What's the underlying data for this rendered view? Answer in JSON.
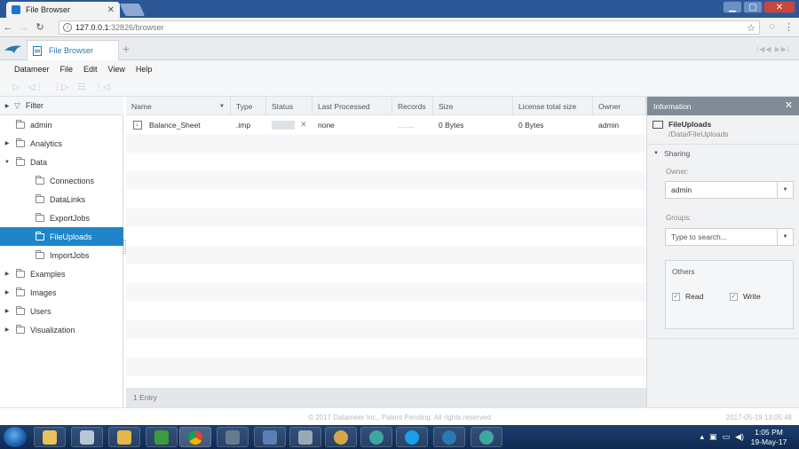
{
  "browser": {
    "tab_title": "File Browser",
    "tab_close": "✕",
    "url_host": "127.0.0.1",
    "url_rest": ":32826/browser",
    "window_buttons": [
      "▁",
      "▢",
      "✕"
    ]
  },
  "app": {
    "tab_label": "File Browser",
    "add_tab": "+",
    "menu": [
      "Datameer",
      "File",
      "Edit",
      "View",
      "Help"
    ]
  },
  "tree": {
    "filter_label": "Filter",
    "items": [
      {
        "label": "admin",
        "indent": 0,
        "caret": false
      },
      {
        "label": "Analytics",
        "indent": 0,
        "caret": true
      },
      {
        "label": "Data",
        "indent": 0,
        "caret": true,
        "open": true
      },
      {
        "label": "Connections",
        "indent": 1,
        "caret": false
      },
      {
        "label": "DataLinks",
        "indent": 1,
        "caret": false
      },
      {
        "label": "ExportJobs",
        "indent": 1,
        "caret": false
      },
      {
        "label": "FileUploads",
        "indent": 1,
        "caret": false,
        "selected": true
      },
      {
        "label": "ImportJobs",
        "indent": 1,
        "caret": false
      },
      {
        "label": "Examples",
        "indent": 0,
        "caret": true
      },
      {
        "label": "Images",
        "indent": 0,
        "caret": true
      },
      {
        "label": "Users",
        "indent": 0,
        "caret": true
      },
      {
        "label": "Visualization",
        "indent": 0,
        "caret": true
      }
    ]
  },
  "table": {
    "columns": [
      "Name",
      "Type",
      "Status",
      "Last Processed",
      "Records",
      "Size",
      "License total size",
      "Owner"
    ],
    "rows": [
      {
        "name": "Balance_Sheet",
        "type": ".imp",
        "status": "",
        "last_processed": "none",
        "records": "........",
        "size": "0 Bytes",
        "license_total_size": "0 Bytes",
        "owner": "admin"
      }
    ],
    "footer": "1 Entry"
  },
  "info": {
    "title": "Information",
    "close": "✕",
    "item_name": "FileUploads",
    "item_path": "/Data/FileUploads",
    "sharing_label": "Sharing",
    "owner_label": "Owner:",
    "owner_value": "admin",
    "groups_label": "Groups:",
    "groups_placeholder": "Type to search...",
    "others_label": "Others",
    "read_label": "Read",
    "write_label": "Write"
  },
  "footer": {
    "copyright": "© 2017 Datameer Inc., Patent Pending. All rights reserved",
    "timestamp": "2017-05-19 13:05:48"
  },
  "taskbar": {
    "time": "1:05 PM",
    "date": "19-May-17"
  }
}
